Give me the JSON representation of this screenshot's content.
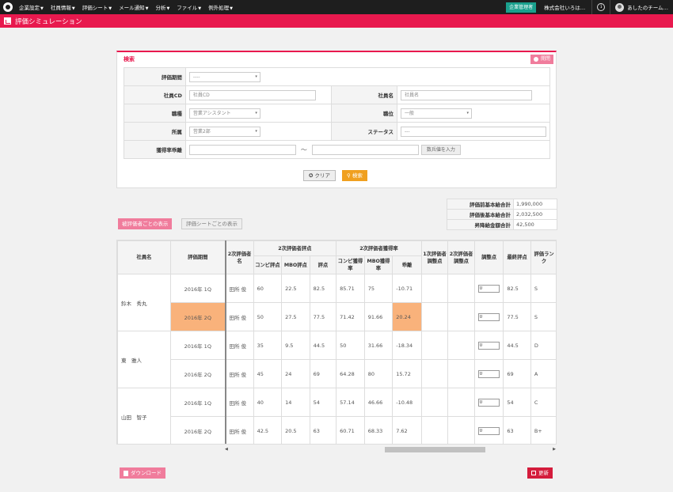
{
  "nav": {
    "menu": [
      "企業設定",
      "社員情報",
      "評価シート",
      "メール通知",
      "分析",
      "ファイル",
      "例外処理"
    ],
    "admin_label": "企業管理者",
    "company": "株式会社いろは…",
    "info": "i",
    "user": "あしたのチーム…"
  },
  "page": {
    "title": "評価シミュレーション"
  },
  "search": {
    "title": "検索",
    "open_label": "開閉",
    "fields": {
      "period_label": "評価期間",
      "period_value": "----",
      "empcd_label": "社員CD",
      "empcd_placeholder": "社員CD",
      "empname_label": "社員名",
      "empname_placeholder": "社員名",
      "jobtype_label": "職種",
      "jobtype_value": "営業アシスタント",
      "position_label": "職位",
      "position_value": "一般",
      "dept_label": "所属",
      "dept_value": "営業2部",
      "status_label": "ステータス",
      "status_value": "---",
      "rate_label": "獲得率乖離",
      "tilde": "～",
      "rate_btn": "数兵値を入力"
    },
    "clear_label": "クリア",
    "search_label": "検索"
  },
  "totals": [
    {
      "label": "評価前基本給合計",
      "value": "1,990,000"
    },
    {
      "label": "評価後基本給合計",
      "value": "2,032,500"
    },
    {
      "label": "昇降給金額合計",
      "value": "42,500"
    }
  ],
  "view_buttons": {
    "by_evaluatee": "被評価者ごとの表示",
    "by_sheet": "評価シートごとの表示"
  },
  "grid": {
    "headers": {
      "name": "社員名",
      "period": "評価期間",
      "evaluator": "2次評価者名",
      "score_group": "2次評価者評点",
      "rate_group": "2次評価者獲得率",
      "compe_score": "コンピ評点",
      "mbo_score": "MBO評点",
      "score": "評点",
      "compe_rate": "コンピ獲得率",
      "mbo_rate": "MBO獲得率",
      "divergence": "乖離",
      "adj1": "1次評価者調整点",
      "adj2": "2次評価者調整点",
      "adj": "調整点",
      "final": "最終評点",
      "rank": "評価ランク"
    },
    "employees": [
      {
        "name": "鈴木　秀丸",
        "rows": [
          {
            "period": "2016年 1Q",
            "evaluator": "田所 俊",
            "compe": "60",
            "mbo": "22.5",
            "score": "82.5",
            "compe_rate": "85.71",
            "mbo_rate": "75",
            "div": "-10.71",
            "adj": "0",
            "final": "82.5",
            "rank": "S",
            "extra": "6"
          },
          {
            "period": "2016年 2Q",
            "evaluator": "田所 俊",
            "compe": "50",
            "mbo": "27.5",
            "score": "77.5",
            "compe_rate": "71.42",
            "mbo_rate": "91.66",
            "div": "20.24",
            "adj": "0",
            "final": "77.5",
            "rank": "S",
            "extra": "6"
          }
        ]
      },
      {
        "name": "東　雅人",
        "rows": [
          {
            "period": "2016年 1Q",
            "evaluator": "田所 俊",
            "compe": "35",
            "mbo": "9.5",
            "score": "44.5",
            "compe_rate": "50",
            "mbo_rate": "31.66",
            "div": "-18.34",
            "adj": "0",
            "final": "44.5",
            "rank": "D",
            "extra": "-2"
          },
          {
            "period": "2016年 2Q",
            "evaluator": "田所 俊",
            "compe": "45",
            "mbo": "24",
            "score": "69",
            "compe_rate": "64.28",
            "mbo_rate": "80",
            "div": "15.72",
            "adj": "0",
            "final": "69",
            "rank": "A",
            "extra": "3"
          }
        ]
      },
      {
        "name": "山田　智子",
        "rows": [
          {
            "period": "2016年 1Q",
            "evaluator": "田所 俊",
            "compe": "40",
            "mbo": "14",
            "score": "54",
            "compe_rate": "57.14",
            "mbo_rate": "46.66",
            "div": "-10.48",
            "adj": "0",
            "final": "54",
            "rank": "C",
            "extra": "0"
          },
          {
            "period": "2016年 2Q",
            "evaluator": "田所 俊",
            "compe": "42.5",
            "mbo": "20.5",
            "score": "63",
            "compe_rate": "60.71",
            "mbo_rate": "68.33",
            "div": "7.62",
            "adj": "0",
            "final": "63",
            "rank": "B+",
            "extra": "2"
          }
        ]
      }
    ]
  },
  "footer": {
    "download_label": "ダウンロード",
    "update_label": "更新"
  },
  "colors": {
    "brand": "#e8194e",
    "highlight": "#f9b27b",
    "search_btn": "#f0a020",
    "admin_btn": "#1aa08d"
  },
  "icons": [
    "logo-icon",
    "info-icon",
    "user-icon",
    "page-icon",
    "gear-icon",
    "clear-icon",
    "search-icon",
    "download-icon",
    "update-icon"
  ]
}
